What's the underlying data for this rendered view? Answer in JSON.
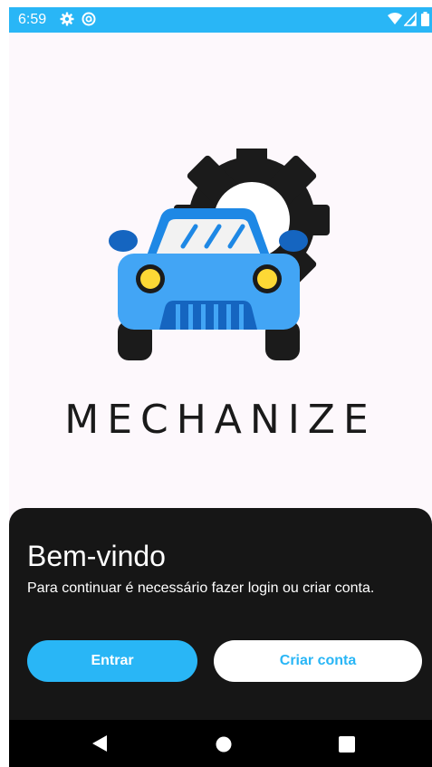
{
  "status_bar": {
    "time": "6:59",
    "icons": [
      "gear-icon",
      "at-sign-icon",
      "wifi-icon",
      "signal-icon",
      "battery-icon"
    ],
    "color": "#29b6f6"
  },
  "logo": {
    "brand": "MECHANIZE",
    "icons": [
      "car-icon",
      "gear-icon"
    ]
  },
  "sheet": {
    "title": "Bem-vindo",
    "message": "Para continuar é necessário fazer login ou criar conta.",
    "login_label": "Entrar",
    "create_label": "Criar conta",
    "accent": "#29b6f6",
    "background": "#161616"
  },
  "nav_bar": {
    "icons": [
      "back-icon",
      "home-icon",
      "recents-icon"
    ]
  }
}
